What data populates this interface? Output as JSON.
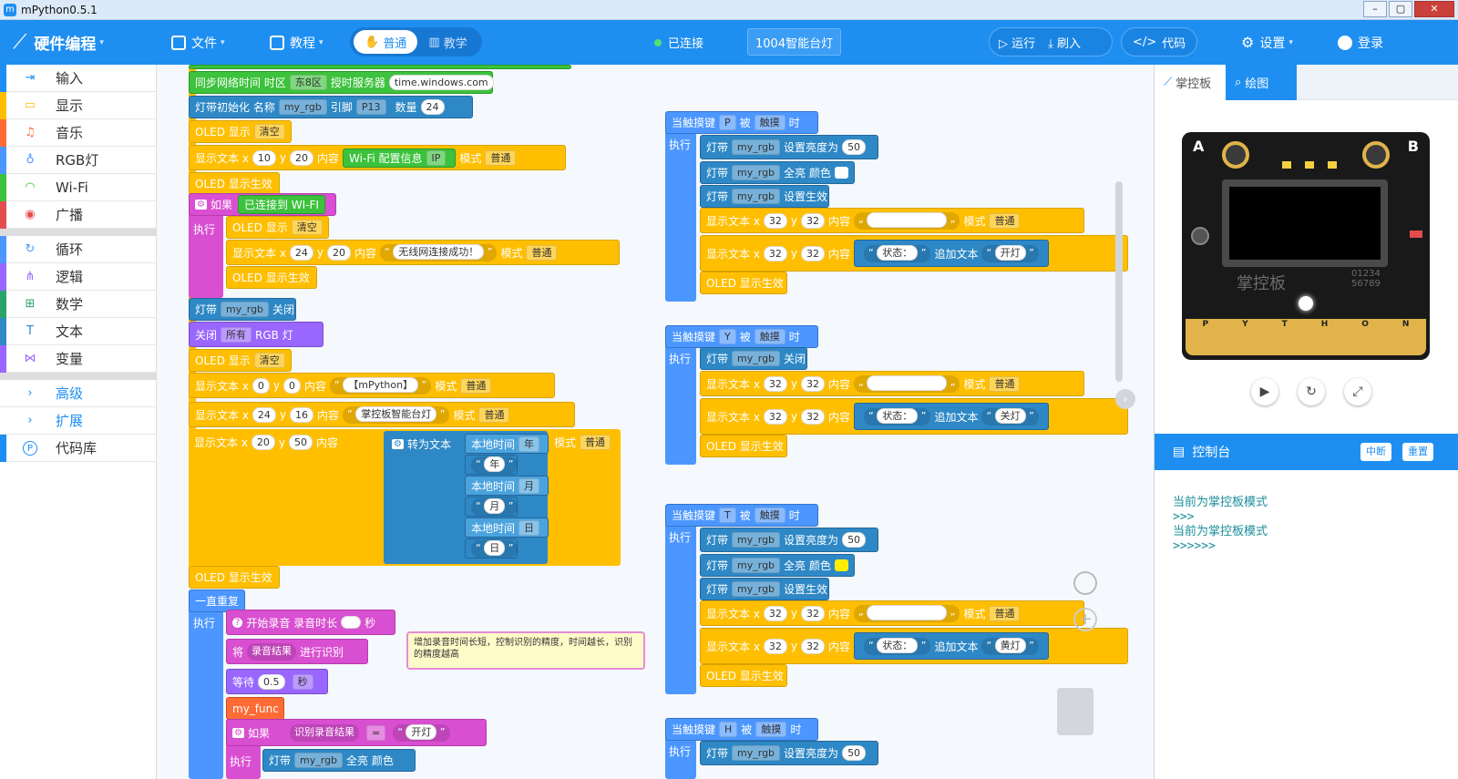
{
  "window": {
    "title": "mPython0.5.1"
  },
  "topbar": {
    "brand": "硬件编程",
    "file": "文件",
    "tutorial": "教程",
    "mode_normal": "普通",
    "mode_teach": "教学",
    "connected": "已连接",
    "device": "1004智能台灯",
    "run": "运行",
    "flash": "刷入",
    "code": "代码",
    "settings": "设置",
    "login": "登录"
  },
  "sidebar": {
    "items": [
      {
        "label": "输入",
        "color": "#1e8ff0"
      },
      {
        "label": "显示",
        "color": "#ffbf00"
      },
      {
        "label": "音乐",
        "color": "#ff6b35"
      },
      {
        "label": "RGB灯",
        "color": "#4c97ff"
      },
      {
        "label": "Wi-Fi",
        "color": "#3cc23c"
      },
      {
        "label": "广播",
        "color": "#e34d4d"
      },
      {
        "label": "循环",
        "color": "#4c97ff"
      },
      {
        "label": "逻辑",
        "color": "#9966ff"
      },
      {
        "label": "数学",
        "color": "#29a36a"
      },
      {
        "label": "文本",
        "color": "#2e88c6"
      },
      {
        "label": "变量",
        "color": "#9966ff"
      },
      {
        "label": "高级",
        "color": "#1e8ff0"
      },
      {
        "label": "扩展",
        "color": "#1e8ff0"
      },
      {
        "label": "代码库",
        "color": "#1e8ff0"
      }
    ]
  },
  "blocks": {
    "ntp": {
      "label": "同步网络时间 时区",
      "tz": "东8区",
      "server_label": "授时服务器",
      "server": "time.windows.com"
    },
    "strip_init": {
      "label": "灯带初始化 名称",
      "name": "my_rgb",
      "pin_label": "引脚",
      "pin": "P13",
      "count_label": "数量",
      "count": "24"
    },
    "oled_clear": "OLED 显示",
    "clear": "清空",
    "show_text": "显示文本 x",
    "y": "y",
    "content": "内容",
    "mode": "模式",
    "normal": "普通",
    "oled_show": "OLED 显示生效",
    "wifi_info": "Wi-Fi 配置信息",
    "ip": "IP",
    "if": "如果",
    "do": "执行",
    "wifi_connected": "已连接到 WI-FI",
    "wifi_success": "无线网连接成功！",
    "strip": "灯带",
    "strip_name": "my_rgb",
    "off": "关闭",
    "close": "关闭",
    "all": "所有",
    "rgb_led": "RGB 灯",
    "mpython": "【mPython】",
    "lamp_title": "掌控板智能台灯",
    "to_text": "转为文本",
    "local_time": "本地时间",
    "year": "年",
    "month": "月",
    "day": "日",
    "forever": "一直重复",
    "start_record": "开始录音 录音时长",
    "sec_unit": "秒",
    "set": "将",
    "record_result": "录音结果",
    "recognize": "进行识别",
    "wait": "等待",
    "wait_val": "0.5",
    "seconds": "秒",
    "my_func": "my_func",
    "recog_result": "识别录音结果",
    "eq": "=",
    "turn_on": "开灯",
    "all_color": "全亮 颜色",
    "brightness": "设置亮度为",
    "apply": "设置生效",
    "when_touch": "当触摸键",
    "touched": "被",
    "touch": "触摸",
    "then": "时",
    "status": "状态：",
    "append": "追加文本",
    "turn_off": "关灯",
    "yellow_light": "黄灯",
    "num_0": "0",
    "num_10": "10",
    "num_16": "16",
    "num_20": "20",
    "num_24": "24",
    "num_32": "32",
    "num_50": "50",
    "key_p": "P",
    "key_y": "Y",
    "key_t": "T",
    "key_h": "H"
  },
  "comment": "增加录音时间长短，控制识别的精度，时间越长，识别的精度越高",
  "rightpanel": {
    "tab_board": "掌控板",
    "tab_draw": "绘图",
    "board_watermark": "掌控板",
    "board_a": "A",
    "board_b": "B",
    "board_digits1": "01234",
    "board_digits2": "56789",
    "board_pins": [
      "P",
      "Y",
      "T",
      "H",
      "O",
      "N"
    ],
    "console_title": "控制台",
    "interrupt": "中断",
    "reset": "重置",
    "console_lines": [
      "当前为掌控板模式",
      ">>>",
      "当前为掌控板模式",
      ">>>>>>"
    ]
  }
}
